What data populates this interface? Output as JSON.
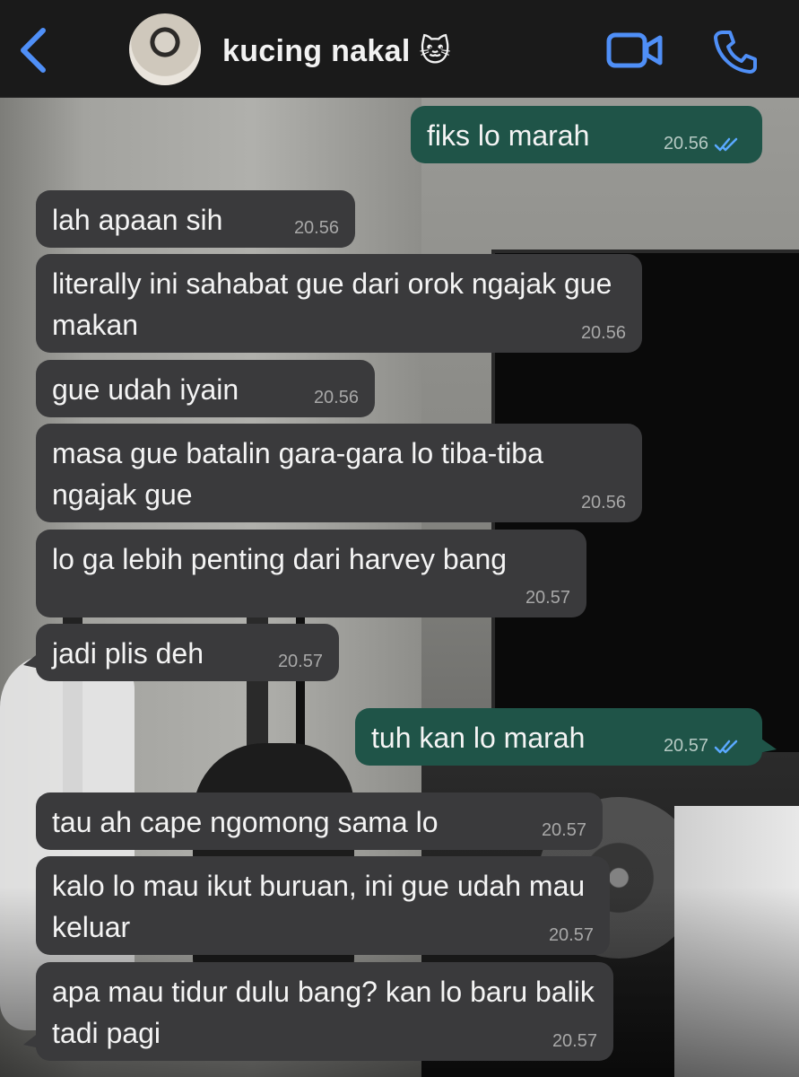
{
  "header": {
    "contact_name": "kucing nakal",
    "contact_emoji": "🐱",
    "icons": [
      "back-chevron-icon",
      "video-call-icon",
      "phone-call-icon"
    ],
    "accent_color": "#4f8ff7"
  },
  "messages": [
    {
      "direction": "out",
      "text": "fiks lo marah",
      "time": "20.56",
      "read": true
    },
    {
      "direction": "in",
      "text": "lah apaan sih",
      "time": "20.56"
    },
    {
      "direction": "in",
      "text": "literally ini sahabat gue dari orok ngajak gue makan",
      "time": "20.56"
    },
    {
      "direction": "in",
      "text": "gue udah iyain",
      "time": "20.56"
    },
    {
      "direction": "in",
      "text": "masa gue batalin gara-gara lo tiba-tiba ngajak gue",
      "time": "20.56"
    },
    {
      "direction": "in",
      "text": "lo ga lebih penting dari harvey bang",
      "time": "20.57"
    },
    {
      "direction": "in",
      "text": "jadi plis deh",
      "time": "20.57"
    },
    {
      "direction": "out",
      "text": "tuh kan lo marah",
      "time": "20.57",
      "read": true
    },
    {
      "direction": "in",
      "text": "tau ah cape ngomong sama lo",
      "time": "20.57"
    },
    {
      "direction": "in",
      "text": "kalo lo mau ikut buruan, ini gue udah mau keluar",
      "time": "20.57"
    },
    {
      "direction": "in",
      "text": "apa mau tidur dulu bang? kan lo baru balik tadi pagi",
      "time": "20.57"
    }
  ],
  "colors": {
    "incoming_bubble": "#3a3a3c",
    "outgoing_bubble": "#1f5448",
    "read_tick": "#5aa9ff"
  }
}
